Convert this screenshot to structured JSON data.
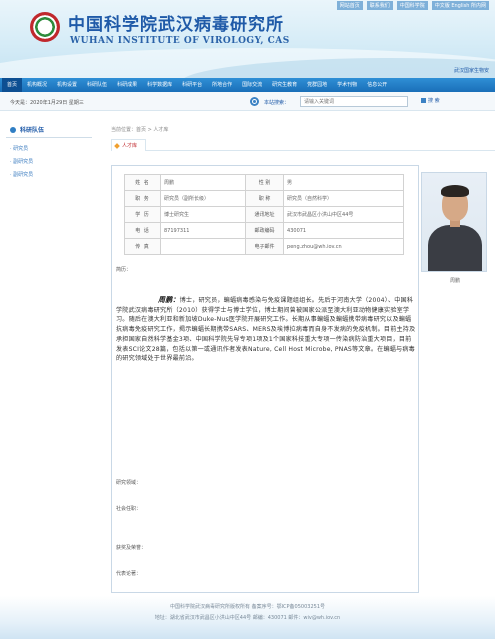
{
  "header": {
    "top_links": [
      "网站首页",
      "联系我们",
      "中国科学院",
      "中文版 English 所内网"
    ],
    "title_cn": "中国科学院武汉病毒研究所",
    "title_en": "WUHAN INSTITUTE OF VIROLOGY, CAS",
    "right_link": "武汉国家生物安"
  },
  "nav": {
    "items": [
      "首页",
      "机构概况",
      "机构设置",
      "科研队伍",
      "科研成果",
      "科学数据库",
      "科研平台",
      "所地合作",
      "国际交流",
      "研究生教育",
      "党群园地",
      "学术刊物",
      "信息公开"
    ],
    "active_index": 0
  },
  "datebar": {
    "date_text": "今天是：2020年1月29日  星期三",
    "search_label": "本站搜索：",
    "search_placeholder": "请输入关键词",
    "search_button": "搜 索"
  },
  "sidebar": {
    "title": "科研队伍",
    "items": [
      "· 研究员",
      "· 副研究员",
      "· 副研究员"
    ]
  },
  "breadcrumb": "当前位置：首页 > 人才库",
  "tab_label": "人才库",
  "profile": {
    "rows": [
      [
        "姓 名",
        "周鹏",
        "性 别",
        "男"
      ],
      [
        "职 务",
        "研究员（副所长级）",
        "职 称",
        "研究员（自然科学）"
      ],
      [
        "学 历",
        "博士研究生",
        "通讯地址",
        "武汉市武昌区小洪山中区44号"
      ],
      [
        "电 话",
        "87197311",
        "邮政编码",
        "430071"
      ],
      [
        "传 真",
        "",
        "电子邮件",
        "peng.zhou@wh.iov.cn"
      ]
    ],
    "photo_caption": "周鹏",
    "section_intro": "简历：",
    "bio_name": "周鹏：",
    "bio_text": "博士，研究员，蝙蝠病毒感染与免疫课题组组长。先后于河南大学（2004）、中国科学院武汉病毒研究所（2010）获得学士与博士学位，博士期间曾被国家公派至澳大利亚动物健康实验室学习。随后在澳大利亚和新加坡Duke-Nus医学院开展研究工作。长期从事蝙蝠及蝙蝠携带病毒研究以及蝙蝠抗病毒免疫研究工作，揭示蝙蝠长期携带SARS、MERS及埃博拉病毒而自身不发病的免疫机制。目前主持及承担国家自然科学基金3项、中国科学院先导专项1项及1个国家科技重大专项一传染病防治重大项目，目前发表SCI论文28篇，包括以第一或通讯作者发表Nature, Cell Host Microbe, PNAS等文章。在蝙蝠与病毒的研究领域处于世界最前沿。",
    "section_research": "研究领域：",
    "section_social": "社会任职：",
    "section_awards": "获奖及荣誉：",
    "section_papers": "代表论著："
  },
  "footer": {
    "line1": "中国科学院武汉病毒研究所版权所有 备案序号：鄂ICP备05003251号",
    "line2": "地址：湖北省武汉市武昌区小洪山中区44号 邮编：430071 邮件：wiv@wh.iov.cn"
  },
  "colors": {
    "nav_blue": "#1a6fb8",
    "title_blue": "#1f5aa8",
    "accent_red": "#c0282d"
  }
}
